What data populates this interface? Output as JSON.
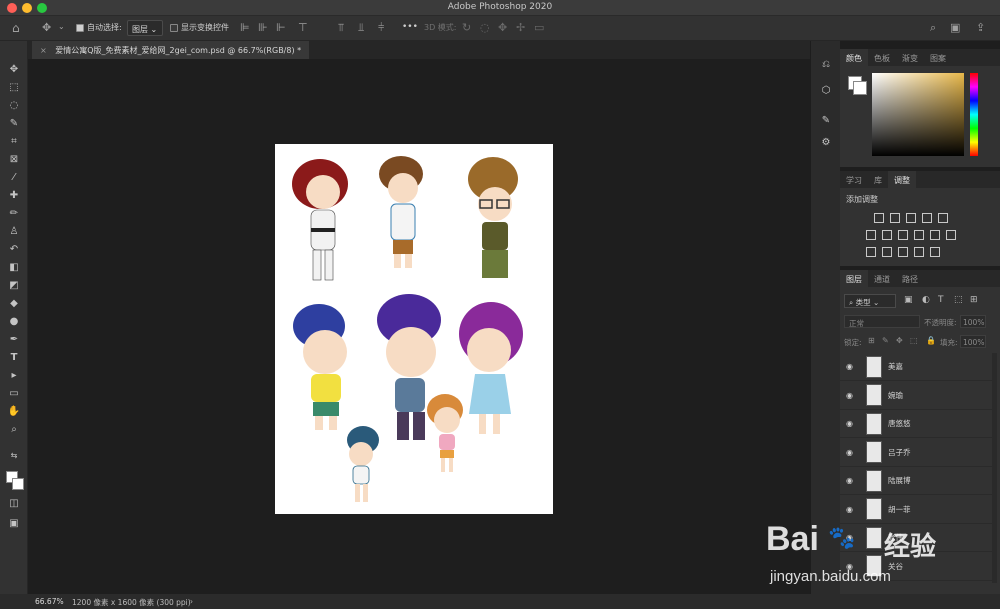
{
  "window": {
    "title": "Adobe Photoshop 2020"
  },
  "options": {
    "auto_select_label": "自动选择:",
    "auto_select_value": "图层",
    "show_transform_label": "显示变换控件",
    "more_label": "•••",
    "mode_3d_label": "3D 模式:"
  },
  "document": {
    "tab_title": "爱情公寓Q版_免费素材_爱给网_2gei_com.psd @ 66.7%(RGB/8) *"
  },
  "status": {
    "zoom": "66.67%",
    "doc_info": "1200 像素 x 1600 像素 (300 ppi)",
    "arrow": "›"
  },
  "color_panel": {
    "tabs": [
      "颜色",
      "色板",
      "渐变",
      "图案"
    ],
    "active_tab": "颜色"
  },
  "adjust_panel": {
    "tabs": [
      "学习",
      "库",
      "调整"
    ],
    "active_tab": "调整",
    "add_label": "添加调整"
  },
  "layers_panel": {
    "tabs": [
      "图层",
      "通道",
      "路径"
    ],
    "active_tab": "图层",
    "filter_label": "类型",
    "blend_mode": "正常",
    "opacity_label": "不透明度:",
    "opacity_value": "100%",
    "lock_label": "锁定:",
    "fill_label": "填充:",
    "fill_value": "100%",
    "layers": [
      "美嘉",
      "婉瑜",
      "唐悠悠",
      "吕子乔",
      "陆展博",
      "胡一菲",
      "张伟",
      "关谷"
    ]
  },
  "watermark": {
    "brand": "Bai",
    "brand_suffix": "经验",
    "url": "jingyan.baidu.com"
  },
  "colors": {
    "accent": "#e8b84a",
    "canvas": "#ffffff",
    "bg": "#1e1e1e"
  }
}
